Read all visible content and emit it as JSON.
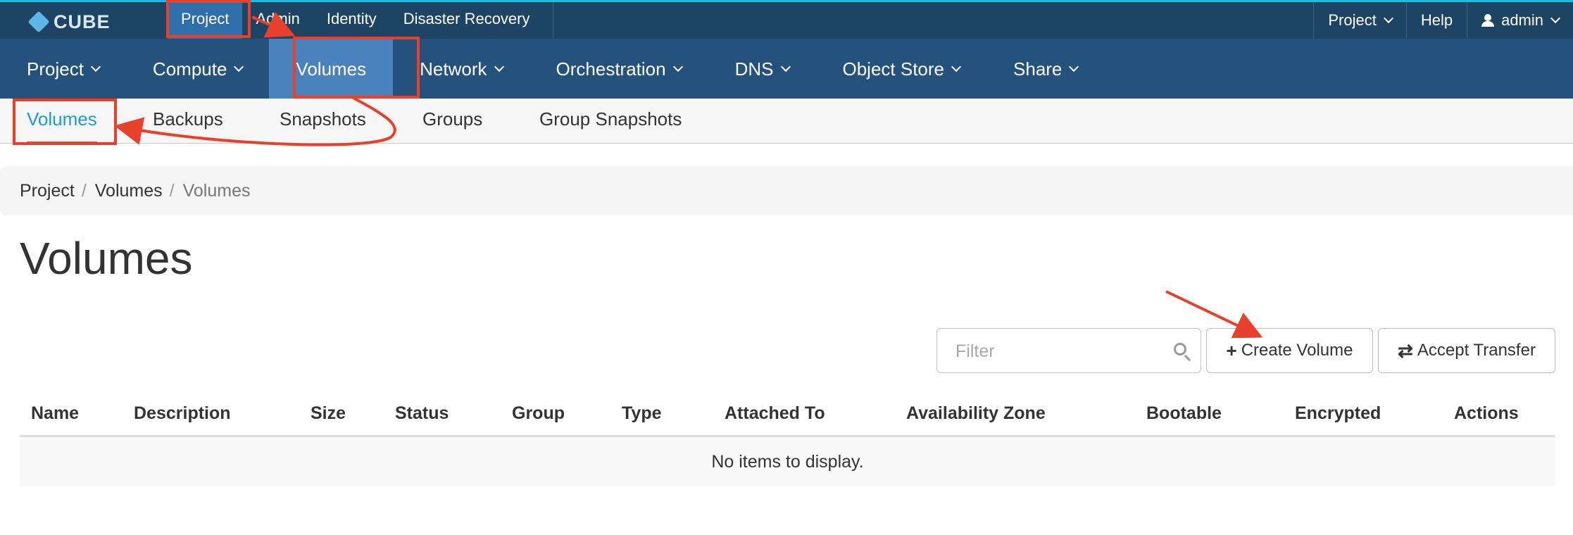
{
  "brand": {
    "name": "CUBE"
  },
  "topnav": {
    "items": [
      "Project",
      "Admin",
      "Identity",
      "Disaster Recovery"
    ],
    "right": {
      "project": "Project",
      "help": "Help",
      "user": "admin"
    }
  },
  "mainnav": {
    "items": [
      "Project",
      "Compute",
      "Volumes",
      "Network",
      "Orchestration",
      "DNS",
      "Object Store",
      "Share"
    ]
  },
  "subnav": {
    "items": [
      "Volumes",
      "Backups",
      "Snapshots",
      "Groups",
      "Group Snapshots"
    ]
  },
  "breadcrumb": [
    "Project",
    "Volumes",
    "Volumes"
  ],
  "page_title": "Volumes",
  "filter": {
    "placeholder": "Filter"
  },
  "buttons": {
    "create": "Create Volume",
    "accept": "Accept Transfer"
  },
  "table": {
    "columns": [
      "Name",
      "Description",
      "Size",
      "Status",
      "Group",
      "Type",
      "Attached To",
      "Availability Zone",
      "Bootable",
      "Encrypted",
      "Actions"
    ],
    "empty_message": "No items to display."
  },
  "colors": {
    "topbar": "#1d4463",
    "mainnav": "#24527c",
    "active_tab": "#4a82bd",
    "link_active": "#1f9bcf",
    "annotation": "#e8402a"
  }
}
